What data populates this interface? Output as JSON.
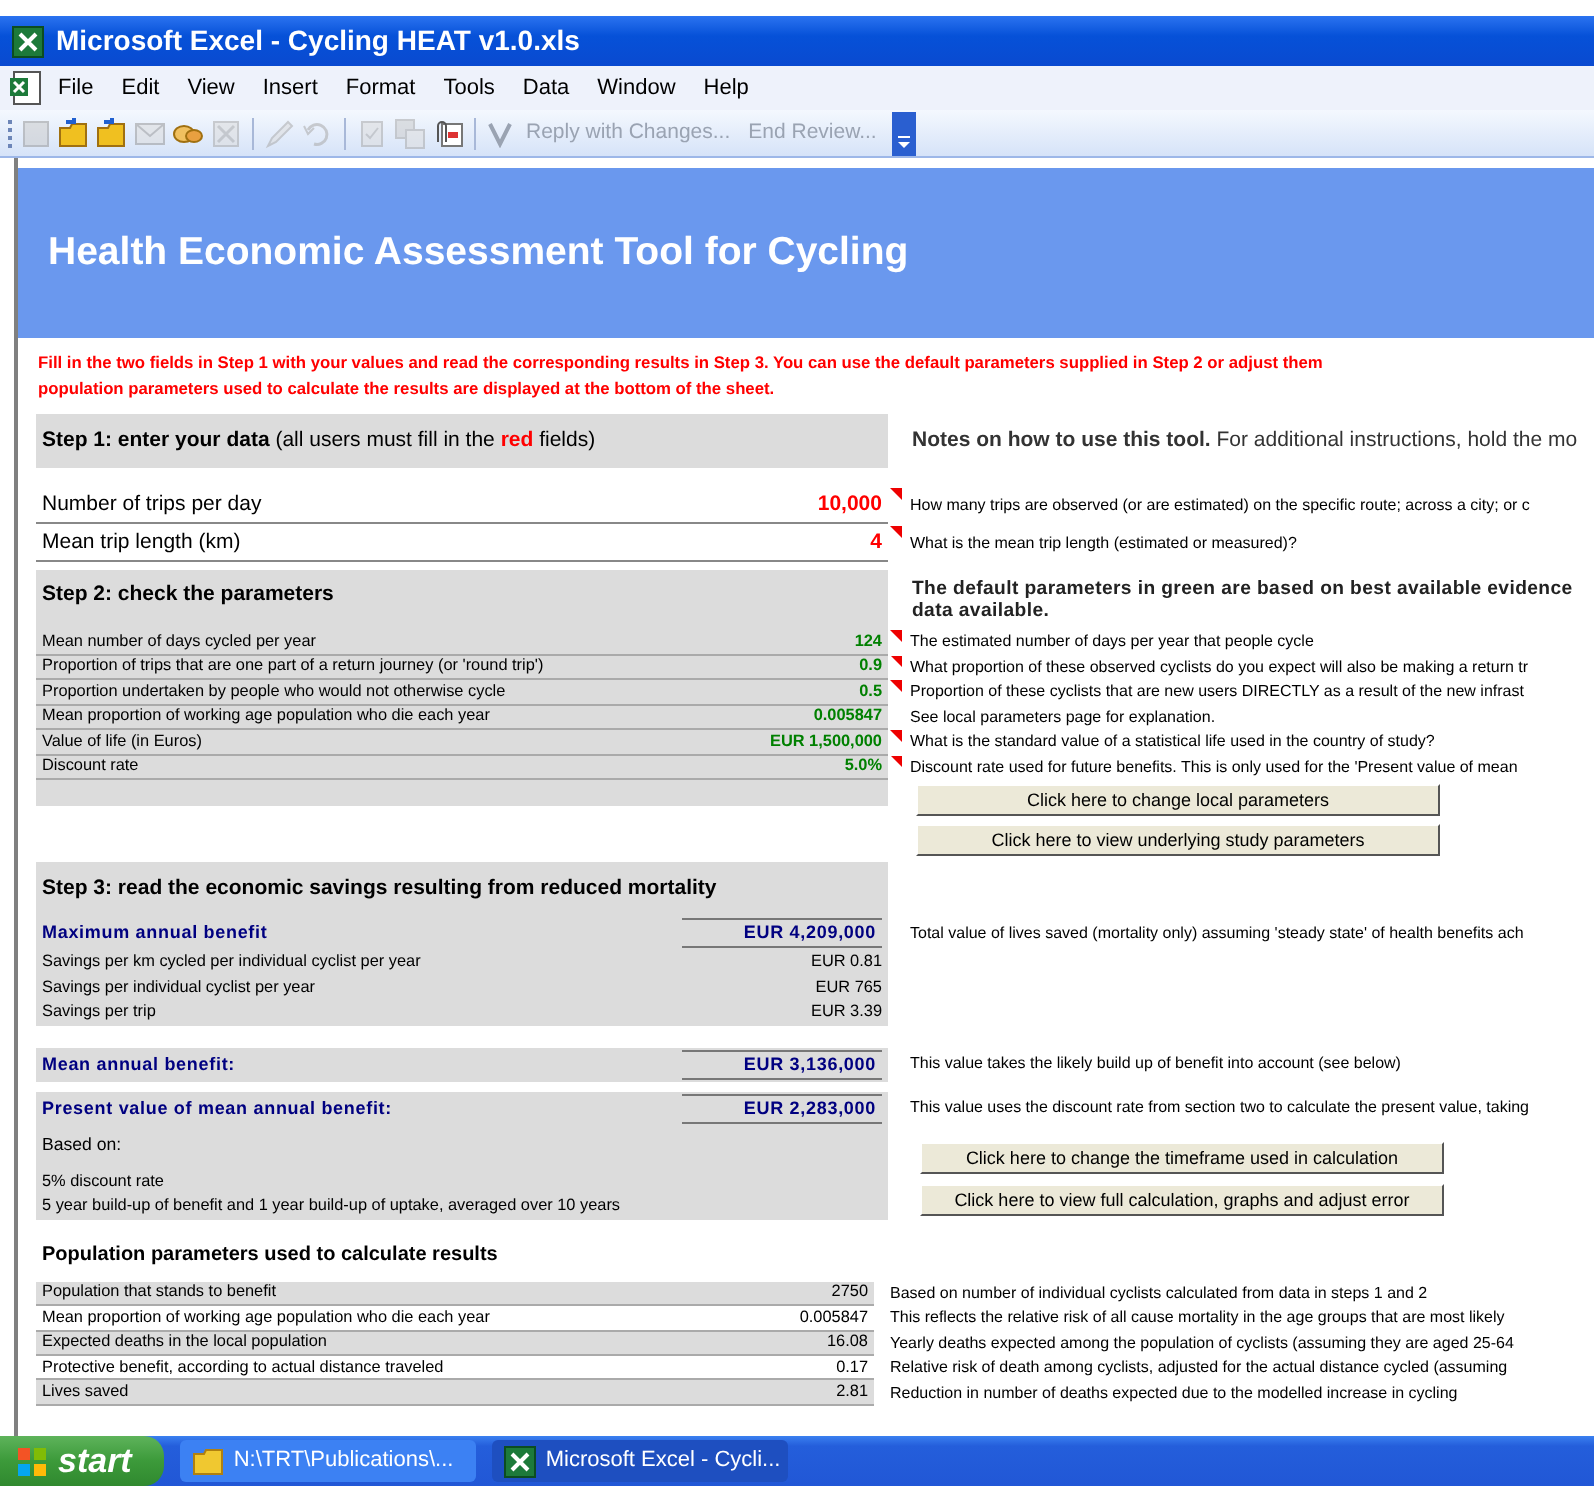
{
  "window": {
    "title": "Microsoft Excel - Cycling HEAT v1.0.xls"
  },
  "menu": [
    "File",
    "Edit",
    "View",
    "Insert",
    "Format",
    "Tools",
    "Data",
    "Window",
    "Help"
  ],
  "toolbar": {
    "icons": [
      {
        "kind": "document",
        "disabled": true
      },
      {
        "kind": "folder",
        "disabled": false
      },
      {
        "kind": "folder",
        "disabled": false
      },
      {
        "kind": "envelope",
        "disabled": true
      },
      {
        "kind": "group",
        "disabled": false
      },
      {
        "kind": "delete",
        "disabled": true
      },
      {
        "kind": "separator"
      },
      {
        "kind": "edit",
        "disabled": true
      },
      {
        "kind": "undo",
        "disabled": true
      },
      {
        "kind": "separator"
      },
      {
        "kind": "check",
        "disabled": true
      },
      {
        "kind": "save",
        "disabled": true
      },
      {
        "kind": "attach",
        "disabled": false
      },
      {
        "kind": "separator"
      }
    ],
    "buttons": [
      {
        "label": "Reply with Changes...",
        "disabled": true
      },
      {
        "label": "End Review...",
        "disabled": true
      }
    ]
  },
  "sheet": {
    "banner_title": "Health Economic Assessment Tool for Cycling",
    "instructions": [
      "Fill in the two fields in Step 1 with your values and read the corresponding results in Step 3. You can use the default parameters supplied in Step 2 or adjust them",
      "population parameters used to calculate the results are displayed at the bottom of the sheet."
    ],
    "step1": {
      "heading": "**Step 1: enter your data** (all users must fill in the **red** fields)",
      "notes_heading": "**Notes on how to use this tool.**  For additional instructions, hold the mo",
      "inputs": [
        {
          "label": "Number of trips per day",
          "value": "10,000",
          "note": "How many trips are observed (or are estimated) on the specific route; across a city; or c",
          "comment": true
        },
        {
          "label": "Mean trip length  (km)",
          "value": "4",
          "note": "What is the mean trip length (estimated or measured)?",
          "comment": true
        }
      ]
    },
    "step2": {
      "heading": "Step 2: check the parameters",
      "notes_heading": [
        "The default parameters in green are based on best available evidence",
        "data available."
      ],
      "parameters": [
        {
          "label": "Mean number of days cycled per year",
          "value": "124",
          "note": "The estimated number of days per year that people cycle",
          "comment": true
        },
        {
          "label": "Proportion of trips that are one part of a return journey (or 'round trip')",
          "value": "0.9",
          "note": "What proportion of these observed cyclists do you expect will also be making a return tr",
          "comment": true
        },
        {
          "label": "Proportion undertaken by people who would not otherwise cycle",
          "value": "0.5",
          "note": "Proportion of these cyclists that are new users DIRECTLY as a result of the new infrast",
          "comment": true
        },
        {
          "label": "Mean proportion of working age population who die each year",
          "value": "0.005847",
          "note": "See local parameters page for explanation.",
          "comment": false
        },
        {
          "label": "Value of life (in Euros)",
          "value": "EUR 1,500,000",
          "note": "What is the standard value of a statistical life used in the country of study?",
          "comment": true
        },
        {
          "label": "Discount rate",
          "value": "5.0%",
          "note": "Discount rate used for future benefits.  This is only used for the 'Present value of mean",
          "comment": true
        }
      ],
      "buttons": [
        "Click here to change local parameters",
        "Click here to view underlying study parameters"
      ]
    },
    "step3": {
      "heading": "Step 3: read the economic savings resulting from reduced mortality",
      "results": [
        {
          "kind": "headline",
          "label": "Maximum annual benefit",
          "value": "EUR 4,209,000",
          "note": "Total value of lives saved (mortality only) assuming 'steady state' of health benefits ach"
        },
        {
          "kind": "detail",
          "label": "Savings per km cycled per individual cyclist per year",
          "value": "EUR 0.81"
        },
        {
          "kind": "detail",
          "label": "Savings per individual cyclist per year",
          "value": "EUR 765"
        },
        {
          "kind": "detail",
          "label": "Savings per trip",
          "value": "EUR 3.39"
        },
        {
          "kind": "headline",
          "label": "Mean annual benefit:",
          "value": "EUR 3,136,000",
          "note": "This value takes the likely build up of benefit into account (see below)"
        },
        {
          "kind": "headline",
          "label": "Present value of mean annual benefit:",
          "value": "EUR 2,283,000",
          "note": "This value uses the discount rate from section two to calculate the present value, taking"
        }
      ],
      "based_on": [
        "Based on:",
        "5% discount rate",
        "5 year build-up of benefit and 1 year build-up of uptake, averaged over 10 years"
      ],
      "buttons": [
        "Click here to change the timeframe used in calculation",
        "Click here to view full calculation, graphs and adjust error"
      ]
    },
    "population": {
      "heading": "Population parameters used to calculate results",
      "rows": [
        {
          "label": "Population that stands to benefit",
          "value": "2750",
          "note": "Based on number of individual cyclists calculated from data in steps 1 and 2"
        },
        {
          "label": "Mean proportion of working age population who die each year",
          "value": "0.005847",
          "note": "This reflects the relative risk of all cause mortality in the age groups that are most likely"
        },
        {
          "label": "Expected deaths in the local population",
          "value": "16.08",
          "note": "Yearly deaths expected among the population of cyclists (assuming they are aged 25-64"
        },
        {
          "label": "Protective benefit, according to actual distance traveled",
          "value": "0.17",
          "note": "Relative risk of death among cyclists, adjusted for the actual distance cycled (assuming"
        },
        {
          "label": "Lives saved",
          "value": "2.81",
          "note": "Reduction in number of deaths expected due to the modelled increase in cycling"
        }
      ]
    }
  },
  "taskbar": {
    "start": "start",
    "tasks": [
      {
        "kind": "folder",
        "label": "N:\\TRT\\Publications\\...",
        "selected": false
      },
      {
        "kind": "excel",
        "label": "Microsoft Excel - Cycli...",
        "selected": true
      }
    ]
  }
}
